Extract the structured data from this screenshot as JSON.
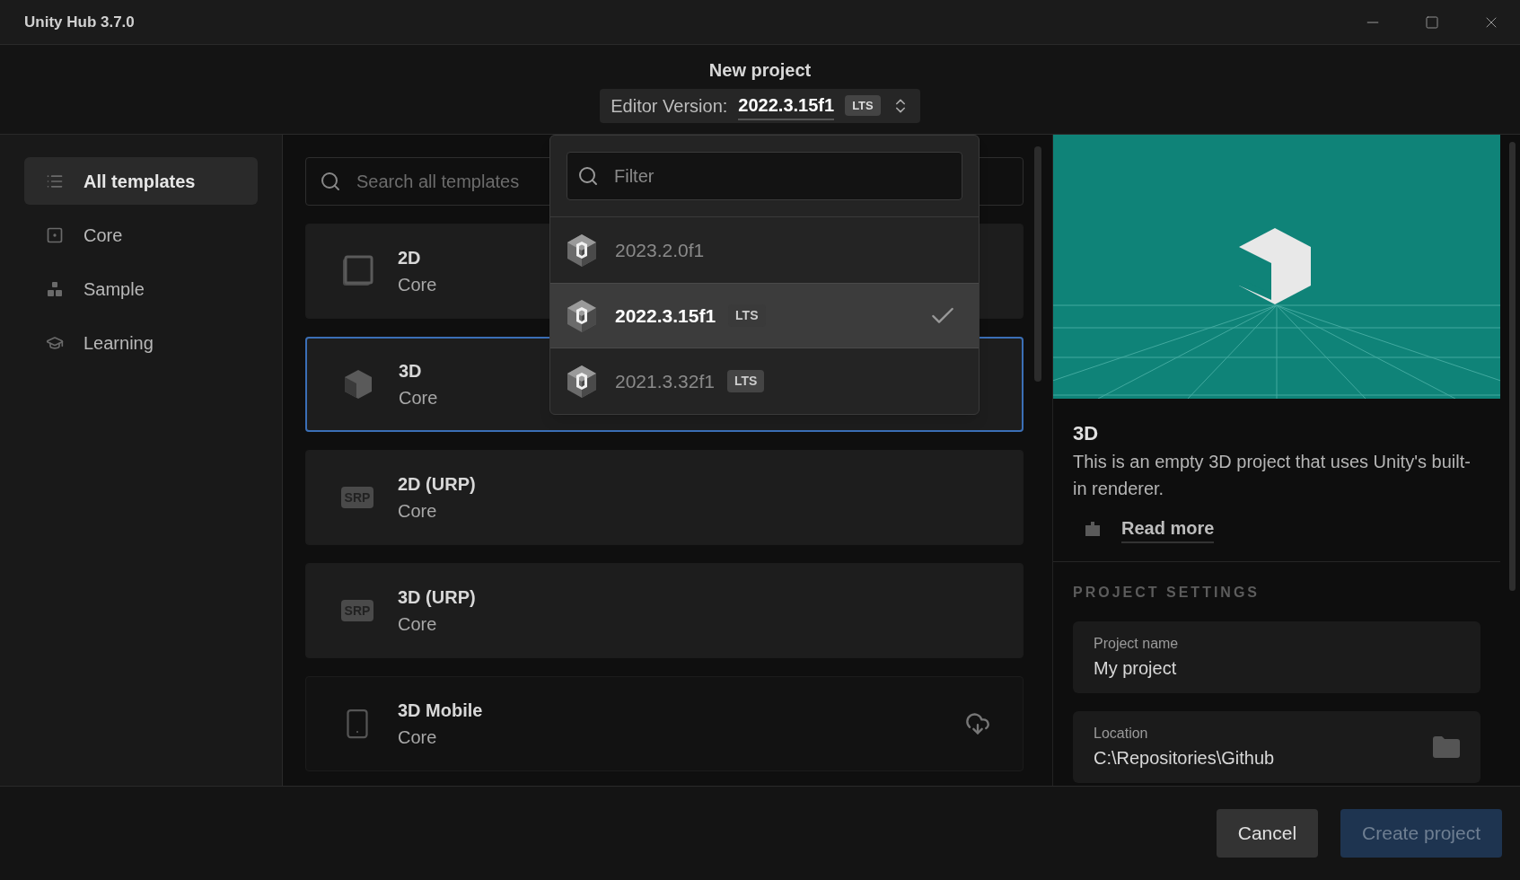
{
  "window": {
    "title": "Unity Hub 3.7.0"
  },
  "header": {
    "title": "New project",
    "editor_version": {
      "label": "Editor Version:",
      "value": "2022.3.15f1",
      "badge": "LTS"
    }
  },
  "sidebar": {
    "items": [
      {
        "label": "All templates",
        "kind": "list",
        "selected": true
      },
      {
        "label": "Core",
        "kind": "core",
        "selected": false
      },
      {
        "label": "Sample",
        "kind": "sample",
        "selected": false
      },
      {
        "label": "Learning",
        "kind": "learning",
        "selected": false
      }
    ]
  },
  "search": {
    "placeholder": "Search all templates"
  },
  "templates": [
    {
      "name": "2D",
      "category": "Core",
      "kind": "square",
      "selected": false,
      "downloadable": false
    },
    {
      "name": "3D",
      "category": "Core",
      "kind": "cube",
      "selected": true,
      "downloadable": false
    },
    {
      "name": "2D (URP)",
      "category": "Core",
      "kind": "srp",
      "icon_text": "SRP",
      "selected": false,
      "downloadable": false
    },
    {
      "name": "3D (URP)",
      "category": "Core",
      "kind": "srp",
      "icon_text": "SRP",
      "selected": false,
      "downloadable": false
    },
    {
      "name": "3D Mobile",
      "category": "Core",
      "kind": "phone",
      "selected": false,
      "downloadable": true
    }
  ],
  "version_dropdown": {
    "filter_placeholder": "Filter",
    "versions": [
      {
        "version": "2023.2.0f1",
        "selected": false
      },
      {
        "version": "2022.3.15f1",
        "badge": "LTS",
        "selected": true
      },
      {
        "version": "2021.3.32f1",
        "badge": "LTS",
        "selected": false
      }
    ]
  },
  "details": {
    "title": "3D",
    "description": "This is an empty 3D project that uses Unity's built-in renderer.",
    "read_more": "Read more"
  },
  "project_settings": {
    "heading": "PROJECT SETTINGS",
    "fields": [
      {
        "label": "Project name",
        "value": "My project",
        "kind": "text"
      },
      {
        "label": "Location",
        "value": "C:\\Repositories\\Github",
        "kind": "folder"
      }
    ]
  },
  "footer": {
    "buttons": [
      {
        "label": "Cancel",
        "kind": "secondary"
      },
      {
        "label": "Create project",
        "kind": "primary"
      }
    ]
  }
}
